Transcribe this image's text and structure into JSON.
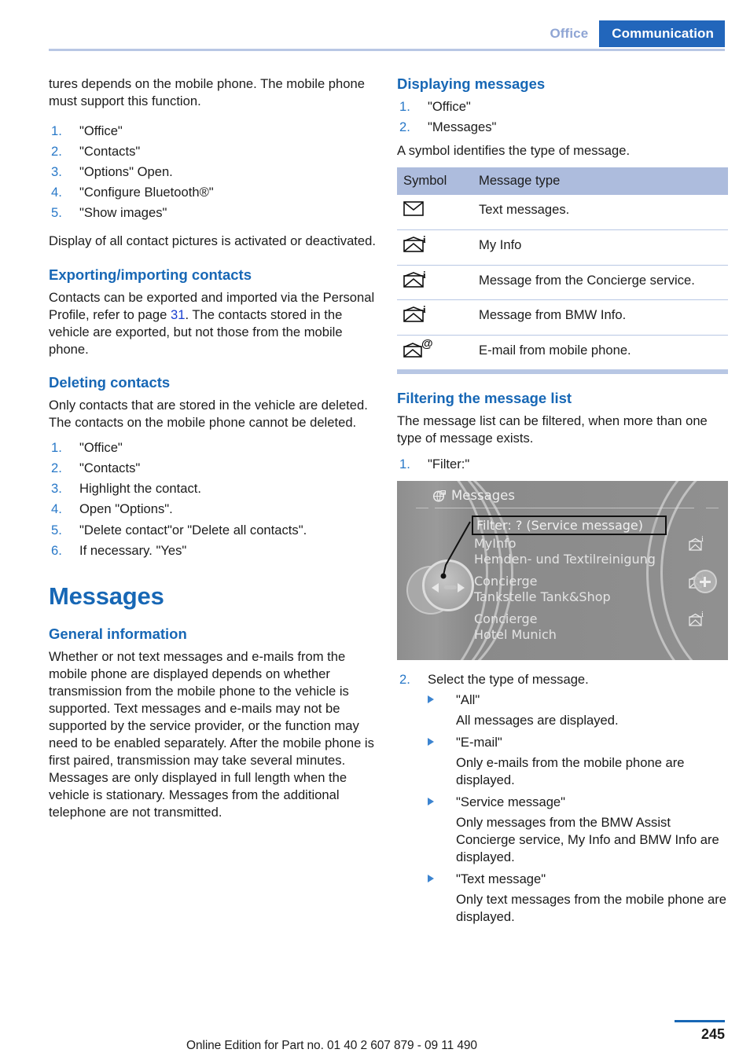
{
  "header": {
    "tab_inactive": "Office",
    "tab_active": "Communication",
    "accent_blue": "#1767b5",
    "tab_bg": "#2266bb"
  },
  "left_column": {
    "intro_paragraph": "tures depends on the mobile phone. The mobile phone must support this function.",
    "steps_images": [
      {
        "num": "1.",
        "text": "\"Office\""
      },
      {
        "num": "2.",
        "text": "\"Contacts\""
      },
      {
        "num": "3.",
        "text": "\"Options\" Open."
      },
      {
        "num": "4.",
        "text": "\"Configure Bluetooth®\""
      },
      {
        "num": "5.",
        "text": "\"Show images\""
      }
    ],
    "after_images_paragraph": "Display of all contact pictures is activated or deactivated.",
    "export_heading": "Exporting/importing contacts",
    "export_p1": "Contacts can be exported and imported via the Personal Profile, refer to page ",
    "export_page_ref": "31",
    "export_p2": ". The contacts stored in the vehicle are exported, but not those from the mobile phone.",
    "delete_heading": "Deleting contacts",
    "delete_paragraph": "Only contacts that are stored in the vehicle are deleted. The contacts on the mobile phone cannot be deleted.",
    "delete_steps": [
      {
        "num": "1.",
        "text": "\"Office\""
      },
      {
        "num": "2.",
        "text": "\"Contacts\""
      },
      {
        "num": "3.",
        "text": "Highlight the contact."
      },
      {
        "num": "4.",
        "text": "Open \"Options\"."
      },
      {
        "num": "5.",
        "text": "\"Delete contact\"or \"Delete all contacts\"."
      },
      {
        "num": "6.",
        "text": "If necessary. \"Yes\""
      }
    ],
    "chapter_title": "Messages",
    "general_heading": "General information",
    "general_paragraph": "Whether or not text messages and e-mails from the mobile phone are displayed depends on whether transmission from the mobile phone to the vehicle is supported. Text messages and e-mails may not be supported by the service provider, or the function may need to be enabled separately. After the mobile phone is first paired, transmission may take several minutes. Messages are only displayed in full length when the vehicle is stationary. Messages from the additional telephone are not transmitted."
  },
  "right_column": {
    "displaying_heading": "Displaying messages",
    "displaying_steps": [
      {
        "num": "1.",
        "text": "\"Office\""
      },
      {
        "num": "2.",
        "text": "\"Messages\""
      }
    ],
    "symbol_intro": "A symbol identifies the type of message.",
    "table": {
      "headers": [
        "Symbol",
        "Message type"
      ],
      "rows": [
        {
          "icon": "envelope-icon",
          "sup": "",
          "type": "Text messages."
        },
        {
          "icon": "envelope-open-info-icon",
          "sup": "i",
          "type": "My Info"
        },
        {
          "icon": "envelope-open-info-icon",
          "sup": "i",
          "type": "Message from the Concierge service."
        },
        {
          "icon": "envelope-open-info-icon",
          "sup": "i",
          "type": "Message from BMW Info."
        },
        {
          "icon": "envelope-open-at-icon",
          "sup": "@",
          "type": "E-mail from mobile phone."
        }
      ]
    },
    "filtering_heading": "Filtering the message list",
    "filtering_paragraph": "The message list can be filtered, when more than one type of message exists.",
    "filter_step": {
      "num": "1.",
      "text": "\"Filter:\""
    },
    "idrive": {
      "menu_title": "Messages",
      "filter_bar": "Filter: ? (Service message)",
      "entries": [
        {
          "title": "MyInfo",
          "subtitle": "Hemden- und Textilreinigung",
          "icon": "envelope-info-icon",
          "sup": "i"
        },
        {
          "title": "Concierge",
          "subtitle": "Tankstelle Tank&Shop",
          "icon": "envelope-info-icon",
          "sup": "i"
        },
        {
          "title": "Concierge",
          "subtitle": "Hotel Munich",
          "icon": "envelope-info-icon",
          "sup": "i"
        }
      ]
    },
    "select_step": {
      "num": "2.",
      "text": "Select the type of message."
    },
    "filter_options": [
      {
        "label": "\"All\"",
        "desc": "All messages are displayed."
      },
      {
        "label": "\"E-mail\"",
        "desc": "Only e-mails from the mobile phone are displayed."
      },
      {
        "label": "\"Service message\"",
        "desc": "Only messages from the BMW Assist Concierge service, My Info and BMW Info are displayed."
      },
      {
        "label": "\"Text message\"",
        "desc": "Only text messages from the mobile phone are displayed."
      }
    ]
  },
  "footer": {
    "edition_text": "Online Edition for Part no. 01 40 2 607 879 - 09 11 490",
    "page_number": "245"
  }
}
